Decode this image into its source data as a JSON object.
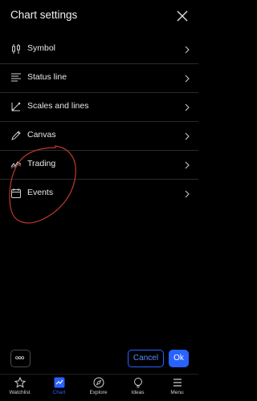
{
  "header": {
    "title": "Chart settings"
  },
  "menu": {
    "items": [
      {
        "label": "Symbol",
        "icon": "candlestick-icon"
      },
      {
        "label": "Status line",
        "icon": "status-line-icon"
      },
      {
        "label": "Scales and lines",
        "icon": "scales-icon"
      },
      {
        "label": "Canvas",
        "icon": "pencil-icon"
      },
      {
        "label": "Trading",
        "icon": "trading-icon"
      },
      {
        "label": "Events",
        "icon": "calendar-icon"
      }
    ]
  },
  "footer": {
    "cancel_label": "Cancel",
    "ok_label": "Ok"
  },
  "tabbar": {
    "active": "Chart",
    "tabs": [
      {
        "label": "Watchlist",
        "icon": "star-icon"
      },
      {
        "label": "Chart",
        "icon": "chart-icon"
      },
      {
        "label": "Explore",
        "icon": "compass-icon"
      },
      {
        "label": "Ideas",
        "icon": "lightbulb-icon"
      },
      {
        "label": "Menu",
        "icon": "hamburger-icon"
      }
    ]
  },
  "colors": {
    "accent": "#2962ff",
    "background": "#000000",
    "annotation": "#c0392b"
  }
}
